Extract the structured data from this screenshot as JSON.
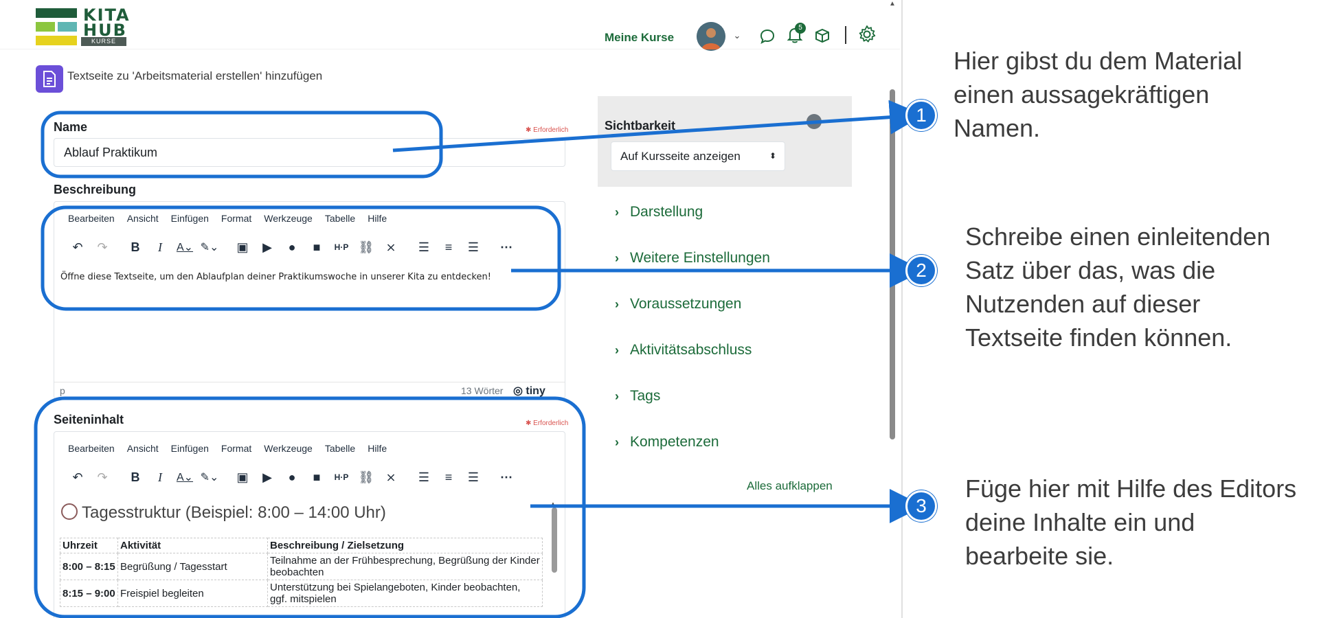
{
  "header": {
    "logo_line1": "KITA",
    "logo_line2": "HUB",
    "logo_sub": "KURSE",
    "nav_my_courses": "Meine Kurse",
    "notification_count": "5",
    "logo_colors": {
      "green": "#1f5c3a",
      "light_green": "#8cc63f",
      "teal": "#5fb6b3",
      "yellow": "#e6d21e"
    }
  },
  "page": {
    "heading": "Textseite zu 'Arbeitsmaterial erstellen' hinzufügen",
    "required_label": "Erforderlich"
  },
  "form": {
    "name_label": "Name",
    "name_value": "Ablauf Praktikum",
    "description_label": "Beschreibung",
    "description_text": "Öffne diese Textseite, um den Ablaufplan deiner Praktikumswoche in unserer Kita zu entdecken!",
    "description_word_count": "13 Wörter",
    "status_path": "p",
    "tiny_brand": "tiny",
    "content_label": "Seiteninhalt"
  },
  "editor_menu": [
    "Bearbeiten",
    "Ansicht",
    "Einfügen",
    "Format",
    "Werkzeuge",
    "Tabelle",
    "Hilfe"
  ],
  "sidebar": {
    "visibility_label": "Sichtbarkeit",
    "visibility_value": "Auf Kursseite anzeigen",
    "sections": [
      "Darstellung",
      "Weitere Einstellungen",
      "Voraussetzungen",
      "Aktivitätsabschluss",
      "Tags",
      "Kompetenzen"
    ],
    "expand_all": "Alles aufklappen"
  },
  "content": {
    "title": "Tagesstruktur (Beispiel: 8:00 – 14:00 Uhr)",
    "table_headers": [
      "Uhrzeit",
      "Aktivität",
      "Beschreibung / Zielsetzung"
    ],
    "rows": [
      [
        "8:00 – 8:15",
        "Begrüßung / Tagesstart",
        "Teilnahme an der Frühbesprechung, Begrüßung der Kinder beobachten"
      ],
      [
        "8:15 – 9:00",
        "Freispiel begleiten",
        "Unterstützung bei Spielangeboten, Kinder beobachten, ggf. mitspielen"
      ]
    ]
  },
  "annotations": {
    "c1_number": "1",
    "c1_text": "Hier gibst du dem Material einen aussagekräftigen Namen.",
    "c2_number": "2",
    "c2_text": "Schreibe einen einleitenden Satz über das, was die Nutzenden auf dieser Textseite finden können.",
    "c3_number": "3",
    "c3_text": "Füge hier mit Hilfe des Editors deine Inhalte ein und bearbeite sie.",
    "highlight_color": "#1a6fd1"
  }
}
